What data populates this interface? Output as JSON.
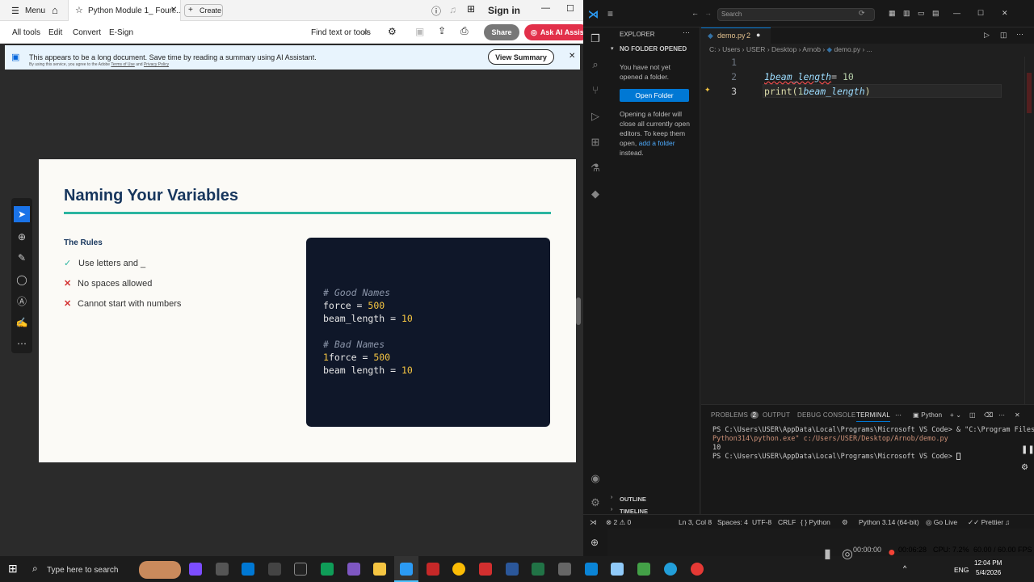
{
  "pdf": {
    "menu_label": "Menu",
    "tab_title": "Python Module 1_ Foun...",
    "create_label": "Create",
    "sign_in": "Sign in",
    "toolbar": {
      "all_tools": "All tools",
      "edit": "Edit",
      "convert": "Convert",
      "esign": "E-Sign",
      "find": "Find text or tools",
      "share": "Share",
      "ask_ai": "Ask AI Assist"
    },
    "banner": {
      "text": "This appears to be a long document. Save time by reading a summary using AI Assistant.",
      "fine_print_prefix": "By using this service, you agree to the Adobe",
      "terms": "Terms of Use",
      "and": "and",
      "privacy": "Privacy Policy",
      "button": "View Summary"
    },
    "slide": {
      "title": "Naming Your Variables",
      "rules_heading": "The Rules",
      "rules": [
        {
          "mark": "✓",
          "text": "Use letters and _"
        },
        {
          "mark": "✕",
          "text": "No spaces allowed"
        },
        {
          "mark": "✕",
          "text": "Cannot start with numbers"
        }
      ],
      "code": {
        "good_comment": "# Good Names",
        "good1_name": "force = ",
        "good1_val": "500",
        "good2_name": "beam_length = ",
        "good2_val": "10",
        "bad_comment": "# Bad Names",
        "bad1_digit": "1",
        "bad1_name": "force = ",
        "bad1_val": "500",
        "bad2_name": "beam length = ",
        "bad2_val": "10"
      }
    }
  },
  "vscode": {
    "search_placeholder": "Search",
    "explorer_title": "EXPLORER",
    "no_folder": "NO FOLDER OPENED",
    "not_opened": "You have not yet opened a folder.",
    "open_folder": "Open Folder",
    "hint_before": "Opening a folder will close all currently open editors. To keep them open,",
    "hint_link": "add a folder",
    "hint_after": "instead.",
    "outline": "OUTLINE",
    "timeline": "TIMELINE",
    "tab_name": "demo.py",
    "tab_badge": "2",
    "breadcrumb": [
      "C:",
      "Users",
      "USER",
      "Desktop",
      "Arnob",
      "demo.py",
      "..."
    ],
    "lines": [
      {
        "num": "1",
        "text": ""
      },
      {
        "num": "2",
        "a": "1beam_length",
        "b": "= ",
        "c": "10"
      },
      {
        "num": "3",
        "a": "print(",
        "b": "1",
        "c": "beam_length",
        "d": ")"
      }
    ],
    "panel_tabs": {
      "problems": "PROBLEMS",
      "problems_count": "2",
      "output": "OUTPUT",
      "debug": "DEBUG CONSOLE",
      "terminal": "TERMINAL",
      "shell": "Python"
    },
    "terminal": [
      "PS C:\\Users\\USER\\AppData\\Local\\Programs\\Microsoft VS Code> & \"C:\\Program Files\\",
      "Python314\\python.exe\" c:/Users/USER/Desktop/Arnob/demo.py",
      "10",
      "PS C:\\Users\\USER\\AppData\\Local\\Programs\\Microsoft VS Code> "
    ],
    "status": {
      "problems": "⊗ 2 ⚠ 0",
      "position": "Ln 3, Col 8",
      "spaces": "Spaces: 4",
      "encoding": "UTF-8",
      "eol": "CRLF",
      "language": "{ } Python",
      "interpreter": "Python 3.14 (64-bit)",
      "golive": "Go Live",
      "prettier": "Prettier"
    }
  },
  "taskbar": {
    "search_placeholder": "Type here to search",
    "recording_time": "00:00:00",
    "rec_time": "00:06:28",
    "cpu": "CPU: 7.2%",
    "fps": "60.00 / 60.00 FPS",
    "lang": "ENG",
    "time": "12:04 PM",
    "date": "5/4/2026"
  },
  "colors": {
    "accent": "#0078d4",
    "slide_title": "#17365d",
    "teal_rule": "#2bb5a0",
    "code_bg": "#0f1729"
  }
}
